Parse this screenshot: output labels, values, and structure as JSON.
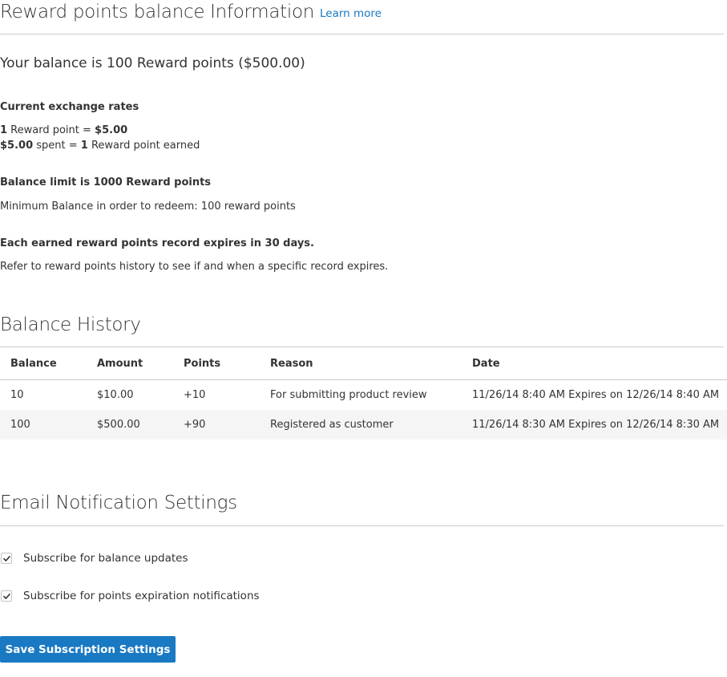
{
  "header": {
    "title": "Reward points balance Information",
    "learn_more": "Learn more"
  },
  "balance": {
    "text": "Your balance is 100 Reward points ($500.00)"
  },
  "exchange_rates": {
    "heading": "Current exchange rates",
    "rate1": {
      "points": "1",
      "text": " Reward point = ",
      "value": "$5.00"
    },
    "rate2": {
      "amount": "$5.00",
      "text": " spent = ",
      "points": "1",
      "suffix": " Reward point earned"
    }
  },
  "limits": {
    "balance_limit": "Balance limit is 1000 Reward points",
    "minimum_balance": "Minimum Balance in order to redeem: 100 reward points"
  },
  "expiration": {
    "heading": "Each earned reward points record expires in 30 days.",
    "note": "Refer to reward points history to see if and when a specific record expires."
  },
  "history": {
    "title": "Balance History",
    "columns": [
      "Balance",
      "Amount",
      "Points",
      "Reason",
      "Date"
    ],
    "rows": [
      [
        "10",
        "$10.00",
        "+10",
        "For submitting product review",
        "11/26/14 8:40 AM Expires on 12/26/14 8:40 AM"
      ],
      [
        "100",
        "$500.00",
        "+90",
        "Registered as customer",
        "11/26/14 8:30 AM Expires on 12/26/14 8:30 AM"
      ]
    ]
  },
  "notifications": {
    "title": "Email Notification Settings",
    "options": [
      {
        "label": "Subscribe for balance updates",
        "checked": true
      },
      {
        "label": "Subscribe for points expiration notifications",
        "checked": true
      }
    ],
    "save_label": "Save Subscription Settings"
  },
  "colors": {
    "accent": "#1979c3",
    "text": "#333333",
    "divider": "#cccccc",
    "stripe": "#f5f5f5"
  }
}
